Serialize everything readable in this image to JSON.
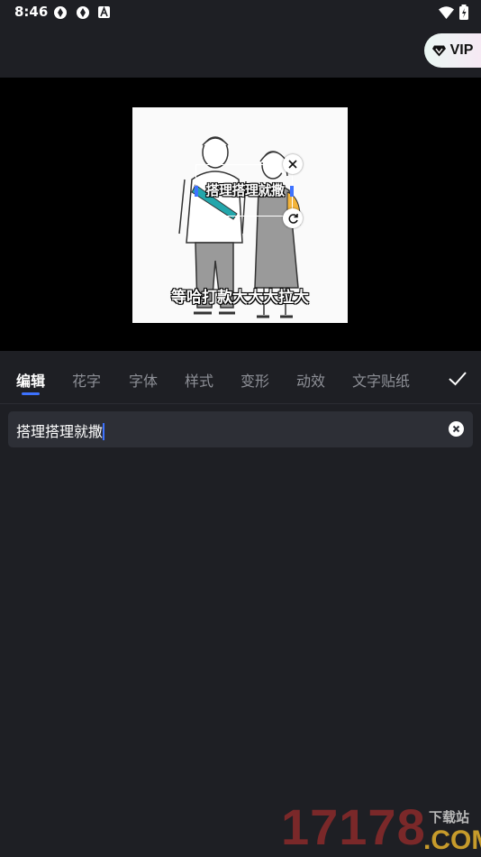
{
  "status_bar": {
    "time": "8:46",
    "left_icons": [
      "camera-shutter-icon",
      "camera-shutter-icon",
      "font-app-icon"
    ],
    "right_icons": [
      "wifi-icon",
      "battery-charging-icon"
    ]
  },
  "header": {
    "vip_label": "VIP",
    "vip_icon": "diamond-icon"
  },
  "preview": {
    "selected_text": "搭理搭理就撒",
    "caption_text": "等哈打款大大大拉大"
  },
  "tabs": [
    {
      "label": "编辑",
      "active": true
    },
    {
      "label": "花字",
      "active": false
    },
    {
      "label": "字体",
      "active": false
    },
    {
      "label": "样式",
      "active": false
    },
    {
      "label": "变形",
      "active": false
    },
    {
      "label": "动效",
      "active": false
    },
    {
      "label": "文字贴纸",
      "active": false
    }
  ],
  "editor": {
    "input_value": "搭理搭理就撒"
  },
  "watermark": {
    "number": "17178",
    "site_label": "下载站",
    "domain": ".COM"
  },
  "colors": {
    "background": "#1e1f24",
    "accent": "#3d72ff",
    "input_bg": "#2d2f36"
  }
}
